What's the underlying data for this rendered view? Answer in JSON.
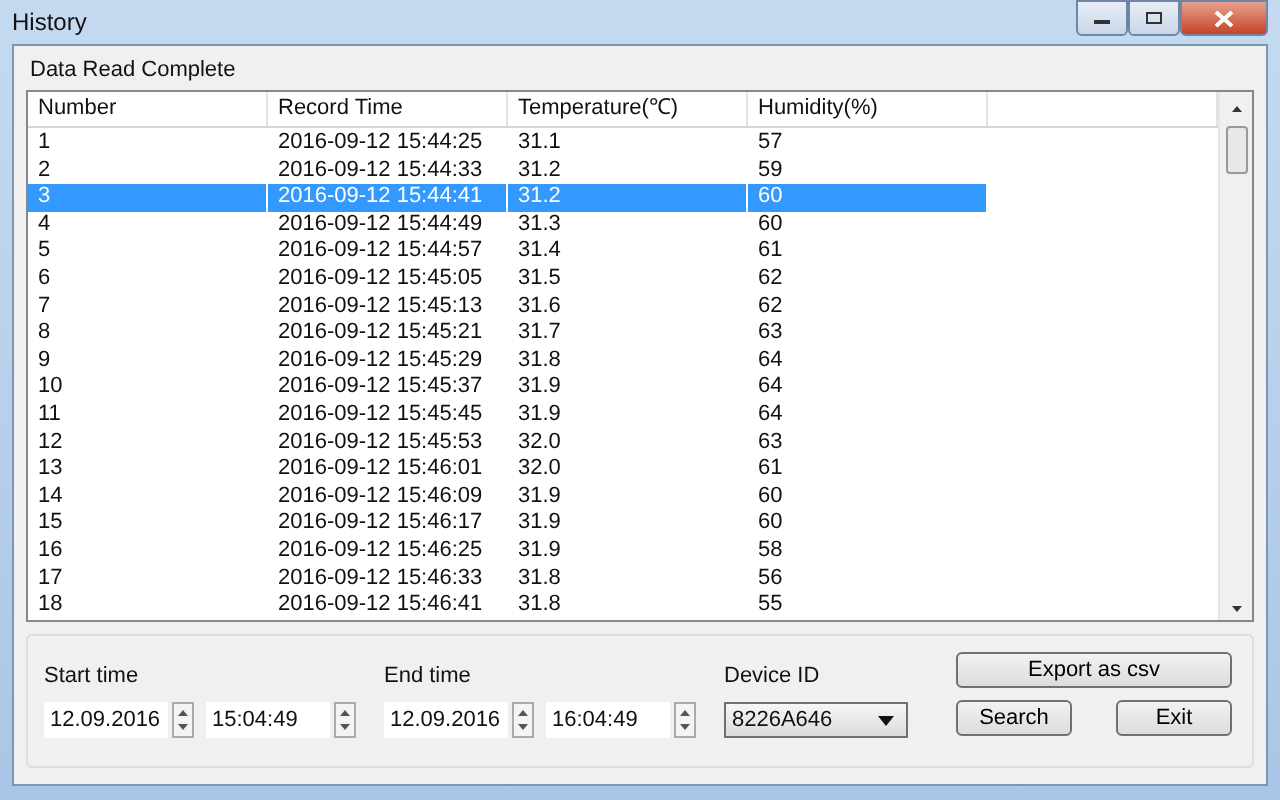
{
  "window": {
    "title": "History"
  },
  "group_title": "Data Read Complete",
  "table": {
    "columns": [
      "Number",
      "Record Time",
      "Temperature(℃)",
      "Humidity(%)"
    ],
    "rows": [
      {
        "cells": [
          "1",
          "2016-09-12 15:44:25",
          "31.1",
          "57"
        ],
        "selected": false
      },
      {
        "cells": [
          "2",
          "2016-09-12 15:44:33",
          "31.2",
          "59"
        ],
        "selected": false
      },
      {
        "cells": [
          "3",
          "2016-09-12 15:44:41",
          "31.2",
          "60"
        ],
        "selected": true
      },
      {
        "cells": [
          "4",
          "2016-09-12 15:44:49",
          "31.3",
          "60"
        ],
        "selected": false
      },
      {
        "cells": [
          "5",
          "2016-09-12 15:44:57",
          "31.4",
          "61"
        ],
        "selected": false
      },
      {
        "cells": [
          "6",
          "2016-09-12 15:45:05",
          "31.5",
          "62"
        ],
        "selected": false
      },
      {
        "cells": [
          "7",
          "2016-09-12 15:45:13",
          "31.6",
          "62"
        ],
        "selected": false
      },
      {
        "cells": [
          "8",
          "2016-09-12 15:45:21",
          "31.7",
          "63"
        ],
        "selected": false
      },
      {
        "cells": [
          "9",
          "2016-09-12 15:45:29",
          "31.8",
          "64"
        ],
        "selected": false
      },
      {
        "cells": [
          "10",
          "2016-09-12 15:45:37",
          "31.9",
          "64"
        ],
        "selected": false
      },
      {
        "cells": [
          "11",
          "2016-09-12 15:45:45",
          "31.9",
          "64"
        ],
        "selected": false
      },
      {
        "cells": [
          "12",
          "2016-09-12 15:45:53",
          "32.0",
          "63"
        ],
        "selected": false
      },
      {
        "cells": [
          "13",
          "2016-09-12 15:46:01",
          "32.0",
          "61"
        ],
        "selected": false
      },
      {
        "cells": [
          "14",
          "2016-09-12 15:46:09",
          "31.9",
          "60"
        ],
        "selected": false
      },
      {
        "cells": [
          "15",
          "2016-09-12 15:46:17",
          "31.9",
          "60"
        ],
        "selected": false
      },
      {
        "cells": [
          "16",
          "2016-09-12 15:46:25",
          "31.9",
          "58"
        ],
        "selected": false
      },
      {
        "cells": [
          "17",
          "2016-09-12 15:46:33",
          "31.8",
          "56"
        ],
        "selected": false
      },
      {
        "cells": [
          "18",
          "2016-09-12 15:46:41",
          "31.8",
          "55"
        ],
        "selected": false
      }
    ]
  },
  "filters": {
    "start_label": "Start time",
    "start_date": "12.09.2016",
    "start_time": "15:04:49",
    "end_label": "End time",
    "end_date": "12.09.2016",
    "end_time": "16:04:49",
    "device_label": "Device ID",
    "device_id": "8226A646"
  },
  "buttons": {
    "export": "Export as csv",
    "search": "Search",
    "exit": "Exit"
  }
}
